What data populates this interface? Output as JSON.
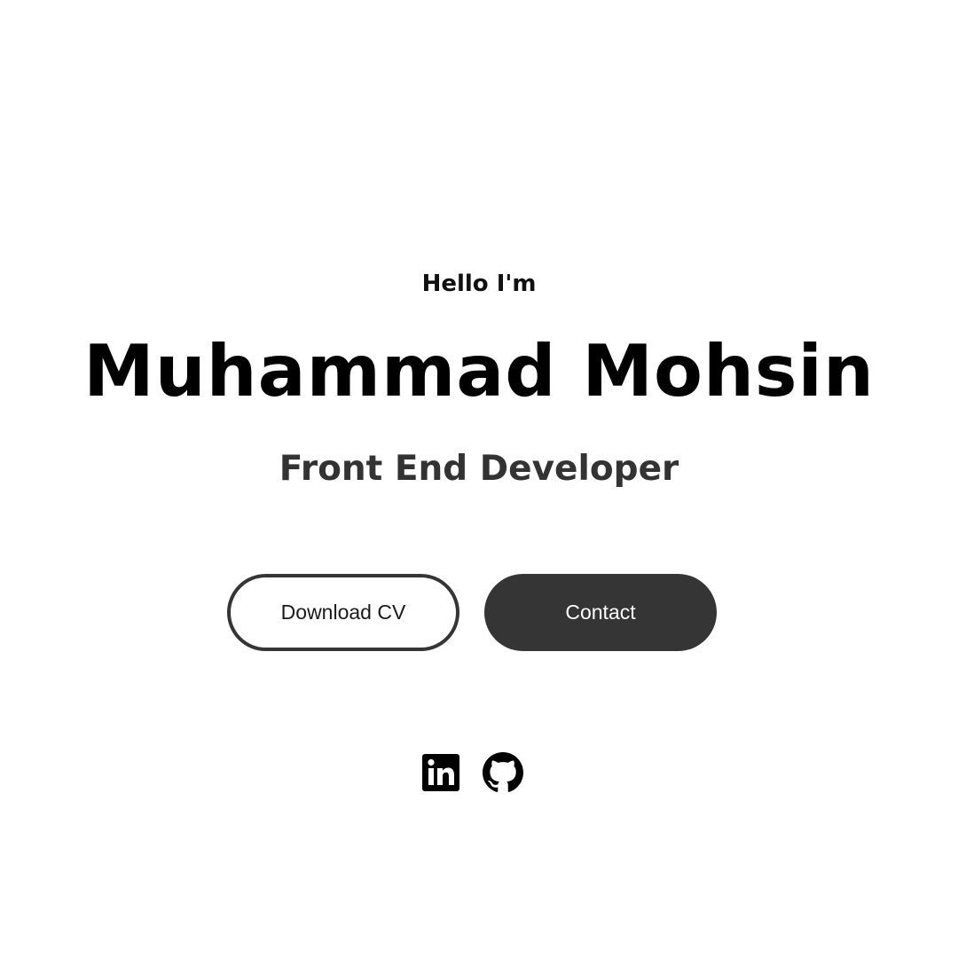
{
  "hero": {
    "greeting": "Hello I'm",
    "name": "Muhammad Mohsin",
    "role": "Front End Developer"
  },
  "buttons": {
    "download_cv": "Download CV",
    "contact": "Contact"
  },
  "socials": [
    {
      "icon": "linkedin-icon"
    },
    {
      "icon": "github-icon"
    }
  ],
  "colors": {
    "background": "#ffffff",
    "button_dark": "#353535",
    "text_primary": "#000000",
    "text_secondary": "#333333"
  }
}
